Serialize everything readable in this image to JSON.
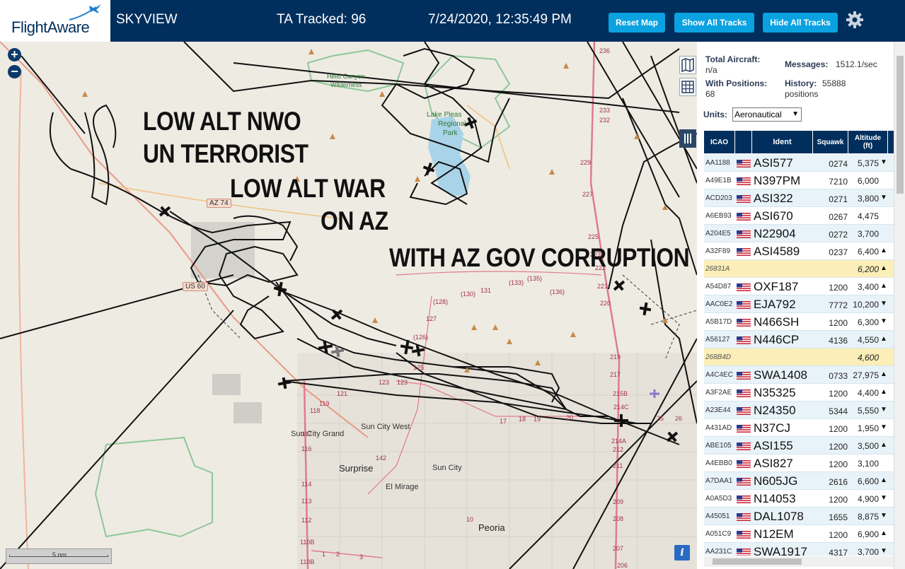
{
  "header": {
    "logo_text": "FlightAware",
    "app_title": "SKYVIEW",
    "tracked": "TA Tracked: 96",
    "datetime": "7/24/2020, 12:35:49 PM",
    "reset_map": "Reset Map",
    "show_all_tracks": "Show All Tracks",
    "hide_all_tracks": "Hide All Tracks",
    "settings_icon": "gear-icon"
  },
  "map": {
    "zoom_in": "+",
    "zoom_out": "−",
    "scale_label": "5 nm",
    "info_label": "i",
    "overlay_text": [
      "LOW ALT NWO",
      "UN TERRORIST",
      "LOW ALT WAR",
      "ON AZ",
      "WITH AZ GOV CORRUPTION"
    ],
    "places": {
      "hells_canyon": "Hells Canyon",
      "wilderness": "Wilderness",
      "lake_pleasant_1": "Lake Pleas",
      "lake_pleasant_2": "Regional",
      "lake_pleasant_3": "Park",
      "sun_city_grand": "Sun City Grand",
      "sun_city_west": "Sun City West",
      "surprise": "Surprise",
      "sun_city": "Sun City",
      "el_mirage": "El Mirage",
      "peoria": "Peoria"
    },
    "shields": {
      "az74": "AZ 74",
      "us60": "US 60"
    },
    "mile_markers": [
      "236",
      "233",
      "232",
      "229",
      "227",
      "225",
      "223",
      "222",
      "221",
      "220",
      "219",
      "217",
      "215B",
      "214C",
      "214A",
      "212",
      "211",
      "209",
      "208",
      "207",
      "206",
      "(128)",
      "131",
      "(133)",
      "(135)",
      "(136)",
      "(130)",
      "127",
      "(126)",
      "125",
      "123",
      "123",
      "121",
      "119",
      "118",
      "117",
      "116",
      "114",
      "113",
      "112",
      "110B",
      "110B",
      "142",
      "17",
      "18",
      "19",
      "20",
      "25",
      "26",
      "10",
      "1",
      "2",
      "3"
    ]
  },
  "panel": {
    "total_label": "Total Aircraft:",
    "total_value": "n/a",
    "messages_label": "Messages:",
    "messages_value": "1512.1/sec",
    "positions_label": "With Positions:",
    "positions_value": "68",
    "history_label": "History:",
    "history_value": "55888",
    "history_unit": "positions",
    "units_label": "Units:",
    "units_value": "Aeronautical",
    "columns": {
      "icao": "ICAO",
      "ident": "Ident",
      "squawk": "Squawk",
      "altitude_1": "Altitude",
      "altitude_2": "(ft)"
    },
    "rows": [
      {
        "icao": "AA1188",
        "ident": "ASI577",
        "squawk": "0274",
        "alt": "5,375",
        "trend": "▼",
        "hl": false
      },
      {
        "icao": "A49E1B",
        "ident": "N397PM",
        "squawk": "7210",
        "alt": "6,000",
        "trend": "",
        "hl": false
      },
      {
        "icao": "ACD203",
        "ident": "ASI322",
        "squawk": "0271",
        "alt": "3,800",
        "trend": "▼",
        "hl": false
      },
      {
        "icao": "A6EB93",
        "ident": "ASI670",
        "squawk": "0267",
        "alt": "4,475",
        "trend": "",
        "hl": false
      },
      {
        "icao": "A204E5",
        "ident": "N22904",
        "squawk": "0272",
        "alt": "3,700",
        "trend": "",
        "hl": false
      },
      {
        "icao": "A32F89",
        "ident": "ASI4589",
        "squawk": "0237",
        "alt": "6,400",
        "trend": "▲",
        "hl": false
      },
      {
        "icao": "26831A",
        "ident": "",
        "squawk": "",
        "alt": "6,200",
        "trend": "▲",
        "hl": true
      },
      {
        "icao": "A54D87",
        "ident": "OXF187",
        "squawk": "1200",
        "alt": "3,400",
        "trend": "▲",
        "hl": false
      },
      {
        "icao": "AAC0E2",
        "ident": "EJA792",
        "squawk": "7772",
        "alt": "10,200",
        "trend": "▼",
        "hl": false
      },
      {
        "icao": "A5B17D",
        "ident": "N466SH",
        "squawk": "1200",
        "alt": "6,300",
        "trend": "▼",
        "hl": false
      },
      {
        "icao": "A56127",
        "ident": "N446CP",
        "squawk": "4136",
        "alt": "4,550",
        "trend": "▲",
        "hl": false
      },
      {
        "icao": "268B4D",
        "ident": "",
        "squawk": "",
        "alt": "4,600",
        "trend": "",
        "hl": true
      },
      {
        "icao": "A4C4EC",
        "ident": "SWA1408",
        "squawk": "0733",
        "alt": "27,975",
        "trend": "▲",
        "hl": false
      },
      {
        "icao": "A3F2AE",
        "ident": "N35325",
        "squawk": "1200",
        "alt": "4,400",
        "trend": "▲",
        "hl": false
      },
      {
        "icao": "A23E44",
        "ident": "N24350",
        "squawk": "5344",
        "alt": "5,550",
        "trend": "▼",
        "hl": false
      },
      {
        "icao": "A431AD",
        "ident": "N37CJ",
        "squawk": "1200",
        "alt": "1,950",
        "trend": "▼",
        "hl": false
      },
      {
        "icao": "ABE105",
        "ident": "ASI155",
        "squawk": "1200",
        "alt": "3,500",
        "trend": "▲",
        "hl": false
      },
      {
        "icao": "A4EBB0",
        "ident": "ASI827",
        "squawk": "1200",
        "alt": "3,100",
        "trend": "",
        "hl": false
      },
      {
        "icao": "A7DAA1",
        "ident": "N605JG",
        "squawk": "2616",
        "alt": "6,600",
        "trend": "▲",
        "hl": false
      },
      {
        "icao": "A0A5D3",
        "ident": "N14053",
        "squawk": "1200",
        "alt": "4,900",
        "trend": "▼",
        "hl": false
      },
      {
        "icao": "A45051",
        "ident": "DAL1078",
        "squawk": "1655",
        "alt": "8,875",
        "trend": "▼",
        "hl": false
      },
      {
        "icao": "A051C9",
        "ident": "N12EM",
        "squawk": "1200",
        "alt": "6,900",
        "trend": "▲",
        "hl": false
      },
      {
        "icao": "AA231C",
        "ident": "SWA1917",
        "squawk": "4317",
        "alt": "3,700",
        "trend": "▼",
        "hl": false
      }
    ]
  },
  "colors": {
    "header_bg": "#002f5d",
    "button_bg": "#0aa2e0",
    "row_alt": "#e8f2f9",
    "row_highlight": "#fbeeb8",
    "map_bg": "#eeebe3",
    "water": "#a9d3e8",
    "highway": "#e07b8c"
  }
}
